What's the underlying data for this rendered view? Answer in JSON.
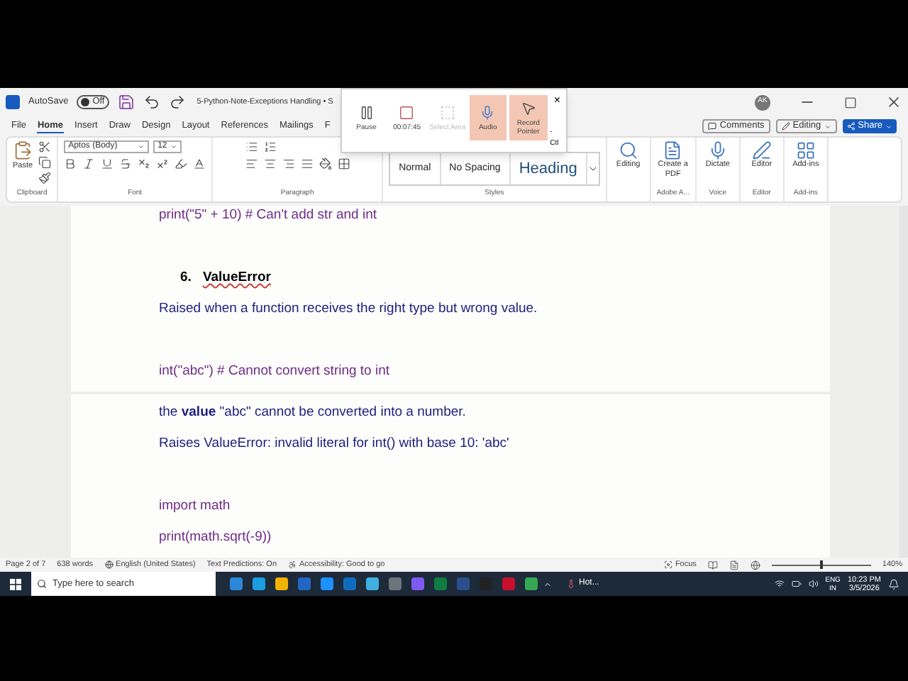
{
  "title_bar": {
    "autosave_label": "AutoSave",
    "autosave": {
      "on": false,
      "label": "Off"
    },
    "title": "5-Python-Note-Exceptions Handling • S",
    "avatar": "AK"
  },
  "recorder": {
    "buttons": [
      {
        "kind": "pause",
        "label": "Pause",
        "on": false,
        "disabled": false
      },
      {
        "kind": "stop",
        "label": "00:07:45",
        "on": false,
        "disabled": false
      },
      {
        "kind": "area",
        "label": "Select Area",
        "on": false,
        "disabled": true
      },
      {
        "kind": "audio",
        "label": "Audio",
        "on": true,
        "disabled": false
      },
      {
        "kind": "pointer",
        "label": "Record Pointer",
        "on": true,
        "disabled": false
      }
    ],
    "close": "×",
    "shortcut": "-Ctl"
  },
  "menu_tabs": [
    {
      "label": "File",
      "selected": false
    },
    {
      "label": "Home",
      "selected": true
    },
    {
      "label": "Insert",
      "selected": false
    },
    {
      "label": "Draw",
      "selected": false
    },
    {
      "label": "Design",
      "selected": false
    },
    {
      "label": "Layout",
      "selected": false
    },
    {
      "label": "References",
      "selected": false
    },
    {
      "label": "Mailings",
      "selected": false
    },
    {
      "label": "F",
      "selected": false
    }
  ],
  "actions": [
    {
      "kind": "comments",
      "label": "Comments"
    },
    {
      "kind": "editing",
      "label": "Editing"
    },
    {
      "kind": "share",
      "label": "Share"
    }
  ],
  "ribbon": {
    "clipboard": {
      "paste": "Paste",
      "label": "Clipboard"
    },
    "font": {
      "font_name": "Aptos (Body)",
      "font_size": "12",
      "label": "Font"
    },
    "paragraph": {
      "label": "Paragraph"
    },
    "styles": {
      "items": [
        {
          "kind": "normal",
          "label": "Normal"
        },
        {
          "kind": "plain",
          "label": "No Spacing"
        },
        {
          "kind": "heading",
          "label": "Heading"
        }
      ],
      "label": "Styles"
    },
    "tools": [
      {
        "kind": "find",
        "label": "Editing"
      },
      {
        "kind": "pdf",
        "label": "Create a PDF",
        "group": "Adobe A..."
      },
      {
        "kind": "dictate",
        "label": "Dictate",
        "group": "Voice"
      },
      {
        "kind": "editor",
        "label": "Editor",
        "group": "Editor"
      },
      {
        "kind": "addins",
        "label": "Add-ins",
        "group": "Add-ins"
      }
    ]
  },
  "document": {
    "pages": [
      {
        "paragraphs": [
          {
            "kind": "code",
            "text": "print(\"5\" + 10)  # Can't add str and int"
          },
          {
            "kind": "heading",
            "number": "6.",
            "text": "ValueError"
          },
          {
            "kind": "text",
            "text": "Raised when a function receives the right type but wrong value."
          },
          {
            "kind": "code",
            "text": "int(\"abc\")  # Cannot convert string to int"
          }
        ]
      },
      {
        "paragraphs": [
          {
            "kind": "text",
            "text": "the **value** \"abc\" cannot be converted into a number."
          },
          {
            "kind": "text",
            "text": "Raises ValueError: invalid literal for int() with base 10: 'abc'"
          },
          {
            "kind": "code",
            "text": "import math"
          },
          {
            "kind": "code",
            "text": "print(math.sqrt(-9))"
          }
        ]
      }
    ]
  },
  "status_bar": {
    "items": [
      "Page 2 of 7",
      "638 words",
      "English (United States)",
      "Text Predictions: On",
      "Accessibility: Good to go"
    ],
    "focus": "Focus",
    "zoom": {
      "level": 0.5,
      "reading": "140%"
    }
  },
  "taskbar": {
    "search": {
      "placeholder": "Type here to search"
    },
    "weather": "Hot...",
    "language": [
      "ENG",
      "IN"
    ],
    "time": "10:23 PM",
    "date": "3/5/2026"
  }
}
